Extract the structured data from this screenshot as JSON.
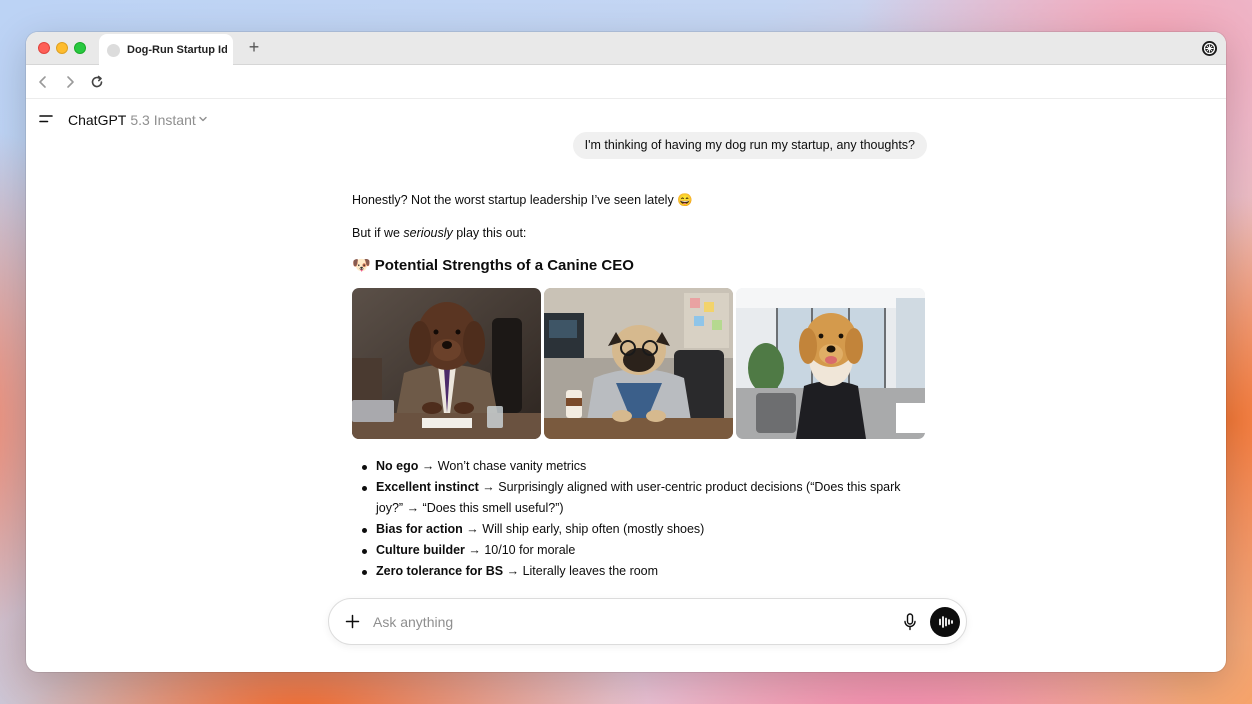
{
  "browser": {
    "tab_title": "Dog-Run Startup Ide",
    "new_tab_symbol": "+"
  },
  "app": {
    "model_name": "ChatGPT",
    "model_version": "5.3 Instant"
  },
  "conversation": {
    "user_message": "I'm thinking of having my dog run my startup, any thoughts?",
    "answer": {
      "intro": "Honestly? Not the worst startup leadership I’ve seen lately",
      "intro_emoji": "😄",
      "line2_pre": "But if we ",
      "line2_em": "seriously",
      "line2_post": " play this out:",
      "heading_emoji": "🐶",
      "heading": "Potential Strengths of a Canine CEO",
      "images": [
        {
          "name": "doodle-in-suit-image"
        },
        {
          "name": "pug-in-hoodie-image"
        },
        {
          "name": "golden-retriever-image"
        }
      ],
      "bullets": [
        {
          "bold": "No ego",
          "text": " → Won’t chase vanity metrics"
        },
        {
          "bold": "Excellent instinct",
          "text": " → Surprisingly aligned with user-centric product decisions (“Does this spark joy?” → “Does this smell useful?”)"
        },
        {
          "bold": "Bias for action",
          "text": " → Will ship early, ship often (mostly shoes)"
        },
        {
          "bold": "Culture builder",
          "text": " → 10/10 for morale"
        },
        {
          "bold": "Zero tolerance for BS",
          "text": " → Literally leaves the room"
        }
      ]
    }
  },
  "composer": {
    "placeholder": "Ask anything"
  },
  "icons": [
    "back-icon",
    "forward-icon",
    "reload-icon",
    "menu-icon",
    "chevron-down-icon",
    "plus-icon",
    "mic-icon",
    "voice-mode-icon",
    "account-icon"
  ],
  "colors": {
    "text": "#0d0d0d",
    "muted": "#8f8f8f",
    "bubble": "#f0f0f0",
    "voice_button": "#0d0d0d"
  }
}
